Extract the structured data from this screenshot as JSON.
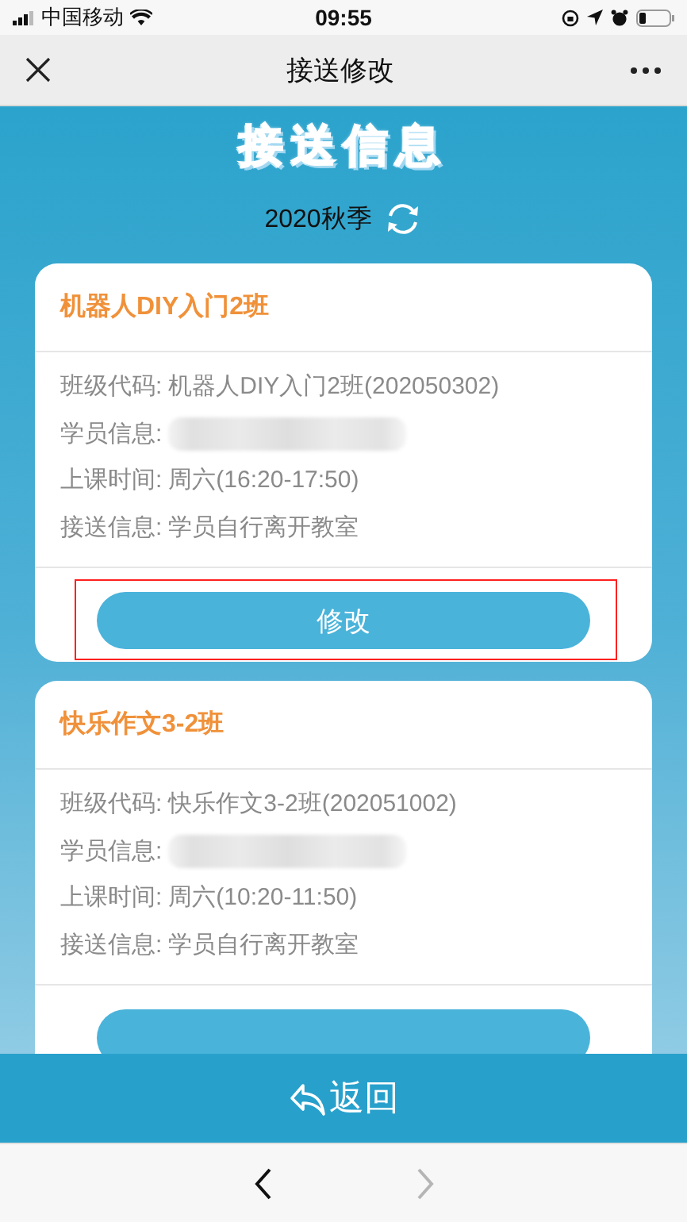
{
  "status_bar": {
    "carrier": "中国移动",
    "time": "09:55"
  },
  "nav_bar": {
    "title": "接送修改"
  },
  "header": {
    "title": "接送信息",
    "season": "2020秋季"
  },
  "cards": [
    {
      "name": "机器人DIY入门2班",
      "highlighted": true,
      "fields": [
        {
          "kind": "text",
          "label": "班级代码:",
          "value": "机器人DIY入门2班(202050302)"
        },
        {
          "kind": "redacted",
          "label": "学员信息:"
        },
        {
          "kind": "text",
          "label": "上课时间:",
          "value": "周六(16:20-17:50)"
        },
        {
          "kind": "text",
          "label": "接送信息:",
          "value": "学员自行离开教室"
        }
      ],
      "button": "修改"
    },
    {
      "name": "快乐作文3-2班",
      "highlighted": false,
      "fields": [
        {
          "kind": "text",
          "label": "班级代码:",
          "value": "快乐作文3-2班(202051002)"
        },
        {
          "kind": "redacted",
          "label": "学员信息:"
        },
        {
          "kind": "text",
          "label": "上课时间:",
          "value": "周六(10:20-11:50)"
        },
        {
          "kind": "text",
          "label": "接送信息:",
          "value": "学员自行离开教室"
        }
      ]
    }
  ],
  "return_button": {
    "label": "返回"
  },
  "browser_nav": {
    "back_disabled": false,
    "forward_disabled": true
  }
}
